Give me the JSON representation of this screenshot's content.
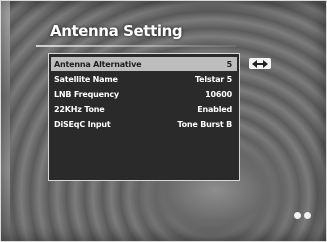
{
  "screen": {
    "title": "Antenna Setting"
  },
  "menu": {
    "rows": [
      {
        "label": "Antenna Alternative",
        "value": "5",
        "selected": true
      },
      {
        "label": "Satellite Name",
        "value": "Telstar 5"
      },
      {
        "label": "LNB Frequency",
        "value": "10600"
      },
      {
        "label": "22KHz Tone",
        "value": "Enabled"
      },
      {
        "label": "DiSEqC Input",
        "value": "Tone Burst B"
      }
    ]
  },
  "hints": {
    "left_right_icon": "left-right-arrows-icon",
    "page_icon": "page-dots-icon"
  },
  "colors": {
    "menu_bg": "#2a2a2a",
    "highlight": "#bdbdbd",
    "text": "#ffffff"
  }
}
